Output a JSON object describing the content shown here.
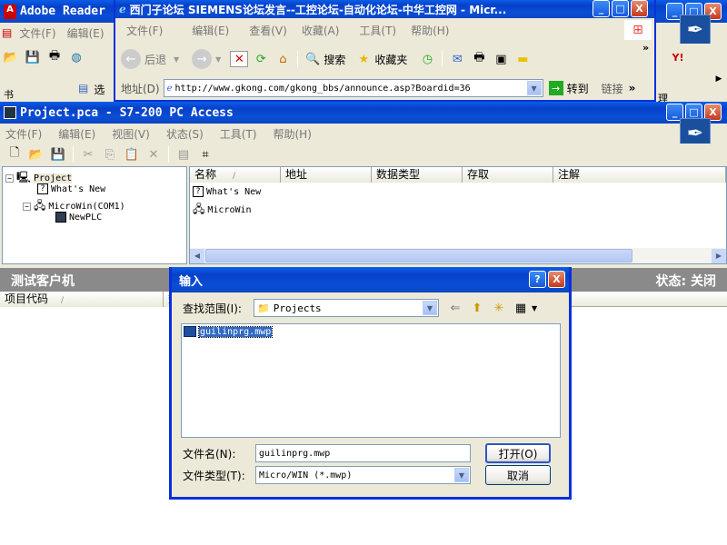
{
  "adobe": {
    "title": "Adobe Reader",
    "menu": [
      "文件(F)",
      "编辑(E)"
    ],
    "side_label": "书",
    "partial_item": "选",
    "right_char": "理"
  },
  "ie": {
    "title": "西门子论坛 SIEMENS论坛发言--工控论坛-自动化论坛-中华工控网 - Micr...",
    "menu": [
      "文件(F)",
      "编辑(E)",
      "查看(V)",
      "收藏(A)",
      "工具(T)",
      "帮助(H)"
    ],
    "back_label": "后退",
    "search_label": "搜索",
    "favorites_label": "收藏夹",
    "address_label": "地址(D)",
    "url": "http://www.gkong.com/gkong_bbs/announce.asp?Boardid=36",
    "go_label": "转到",
    "links_label": "链接",
    "chevron": "»"
  },
  "s7": {
    "title": "Project.pca - S7-200 PC Access",
    "menu": [
      "文件(F)",
      "编辑(E)",
      "视图(V)",
      "状态(S)",
      "工具(T)",
      "帮助(H)"
    ],
    "tree": {
      "root": "Project",
      "whats_new": "What's New",
      "microwin": "MicroWin(COM1)",
      "newplc": "NewPLC"
    },
    "list_headers": [
      "名称",
      "地址",
      "数据类型",
      "存取",
      "注解"
    ],
    "list_items": [
      "What's New",
      "MicroWin"
    ],
    "test_client": "测试客户机",
    "status_label": "状态: 关闭",
    "bottom_header": "项目代码",
    "bottom_header2": "数"
  },
  "dialog": {
    "title": "输入",
    "look_in_label": "查找范围(I):",
    "look_in_value": "Projects",
    "files": [
      "guilinprg.mwp"
    ],
    "filename_label": "文件名(N):",
    "filename_value": "guilinprg.mwp",
    "filetype_label": "文件类型(T):",
    "filetype_value": "Micro/WIN (*.mwp)",
    "open_label": "打开(O)",
    "cancel_label": "取消",
    "help_glyph": "?",
    "close_glyph": "X"
  },
  "glyphs": {
    "minimize": "_",
    "maximize": "□",
    "close": "X"
  }
}
